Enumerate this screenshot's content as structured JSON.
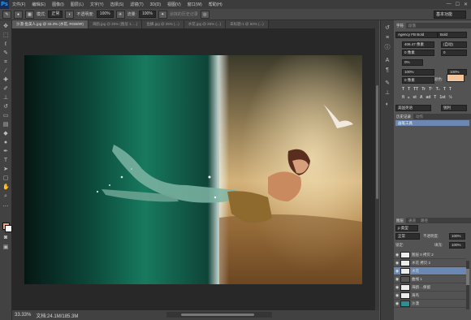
{
  "app": {
    "logo": "Ps"
  },
  "menu": [
    "文件(F)",
    "编辑(E)",
    "图像(I)",
    "图层(L)",
    "文字(Y)",
    "选择(S)",
    "滤镜(T)",
    "3D(D)",
    "视图(V)",
    "窗口(W)",
    "帮助(H)"
  ],
  "window_controls": [
    "—",
    "☐",
    "✕"
  ],
  "options": {
    "mode_label": "模式:",
    "mode_value": "正常",
    "opacity_label": "不透明度:",
    "opacity_value": "100%",
    "flow_label": "流量:",
    "flow_value": "100%",
    "history_label": "涂抹的历史记录",
    "workspace": "基本功能"
  },
  "tabs": [
    {
      "label": "沙漠-鱼美人.jpg @ 33.3% (水花, RGB/8#)",
      "active": true
    },
    {
      "label": "海鸥.jpg @ 25% (图层 1, ...)",
      "active": false
    },
    {
      "label": "鱼鳞.jpg @ 25% (...)",
      "active": false
    },
    {
      "label": "水花.jpg @ 25% (...)",
      "active": false
    },
    {
      "label": "未标题-1 @ 50% (...)",
      "active": false
    }
  ],
  "status": {
    "zoom": "33.33%",
    "doc": "文档:24.1M/185.3M"
  },
  "character_panel": {
    "tabs": [
      "字符",
      "段落"
    ],
    "font_family": "Agency FB Bold",
    "font_style": "Bold",
    "font_size": "406.47 像素",
    "leading": "(自动)",
    "kerning": "0 像素",
    "tracking": "0",
    "scale_v": "0%",
    "scale_h": "100%",
    "baseline": "0 像素",
    "color_label": "颜色:",
    "aa": "100%",
    "lang": "美国英语",
    "aa_mode": "锐利",
    "swatch_color": "#f2c59a",
    "glyphs": [
      "T",
      "T",
      "TT",
      "Tr",
      "T¹",
      "T₁",
      "T",
      "T"
    ],
    "glyphs2": [
      "fi",
      "ℴ",
      "st",
      "A",
      "ad",
      "T",
      "1st",
      "½"
    ]
  },
  "history_panel": {
    "tabs": [
      "历史记录",
      "动作"
    ],
    "items": [
      "画笔工具"
    ]
  },
  "layers_panel": {
    "tabs": [
      "图层",
      "通道",
      "路径"
    ],
    "kind": "ρ 类型",
    "blend": "正常",
    "opacity_label": "不透明度:",
    "opacity": "100%",
    "lock_label": "锁定:",
    "fill_label": "填充:",
    "fill": "100%",
    "layers": [
      {
        "name": "图层 0 拷贝 2",
        "selected": false
      },
      {
        "name": "水花 拷贝 2",
        "selected": false
      },
      {
        "name": "水花",
        "selected": true
      },
      {
        "name": "曲线 1",
        "selected": false
      },
      {
        "name": "海鸥 ...保留",
        "selected": false
      },
      {
        "name": "海鸟",
        "selected": false
      },
      {
        "name": "沙漠",
        "selected": false
      }
    ]
  }
}
